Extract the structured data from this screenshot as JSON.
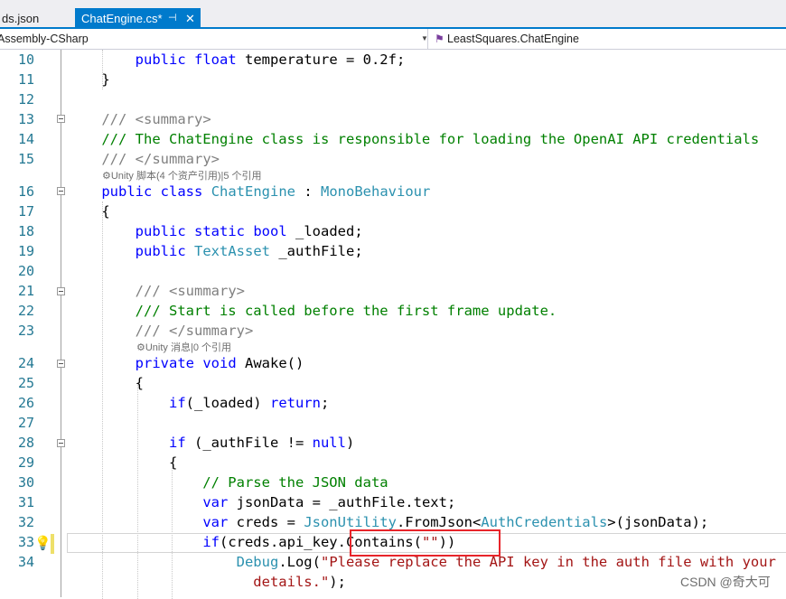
{
  "tabs": {
    "inactive_label": "ds.json",
    "active_label": "ChatEngine.cs*",
    "pin_glyph": "⊣",
    "close_glyph": "✕"
  },
  "navbar": {
    "project": "Assembly-CSharp",
    "type_icon": "class-icon",
    "type_name": "LeastSquares.ChatEngine"
  },
  "editor": {
    "lines": [
      {
        "num": "10",
        "text": "        public float temperature = 0.2f;"
      },
      {
        "num": "11",
        "text": "    }"
      },
      {
        "num": "12",
        "text": ""
      },
      {
        "num": "13",
        "text": "    /// <summary>"
      },
      {
        "num": "14",
        "text": "    /// The ChatEngine class is responsible for loading the OpenAI API credentials"
      },
      {
        "num": "15",
        "text": "    /// </summary>"
      },
      {
        "num": "16",
        "text": "    public class ChatEngine : MonoBehaviour"
      },
      {
        "num": "17",
        "text": "    {"
      },
      {
        "num": "18",
        "text": "        public static bool _loaded;"
      },
      {
        "num": "19",
        "text": "        public TextAsset _authFile;"
      },
      {
        "num": "20",
        "text": ""
      },
      {
        "num": "21",
        "text": "        /// <summary>"
      },
      {
        "num": "22",
        "text": "        /// Start is called before the first frame update."
      },
      {
        "num": "23",
        "text": "        /// </summary>"
      },
      {
        "num": "24",
        "text": "        private void Awake()"
      },
      {
        "num": "25",
        "text": "        {"
      },
      {
        "num": "26",
        "text": "            if(_loaded) return;"
      },
      {
        "num": "27",
        "text": ""
      },
      {
        "num": "28",
        "text": "            if (_authFile != null)"
      },
      {
        "num": "29",
        "text": "            {"
      },
      {
        "num": "30",
        "text": "                // Parse the JSON data"
      },
      {
        "num": "31",
        "text": "                var jsonData = _authFile.text;"
      },
      {
        "num": "32",
        "text": "                var creds = JsonUtility.FromJson<AuthCredentials>(jsonData);"
      },
      {
        "num": "33",
        "text": "                if(creds.api_key.Contains(\"\"))"
      },
      {
        "num": "34",
        "text": "                    Debug.Log(\"Please replace the API key in the auth file with your"
      },
      {
        "num": "",
        "text": "                      details.\");"
      }
    ],
    "codelens_class": "⚙Unity 脚本(4 个资产引用)|5 个引用",
    "codelens_method": "⚙Unity 消息|0 个引用"
  },
  "watermark": "CSDN @奇大可",
  "colors": {
    "keyword": "#0000ff",
    "type": "#2b91af",
    "comment": "#008000",
    "string": "#a31515",
    "accent": "#007acc",
    "highlight": "#e8242a"
  }
}
